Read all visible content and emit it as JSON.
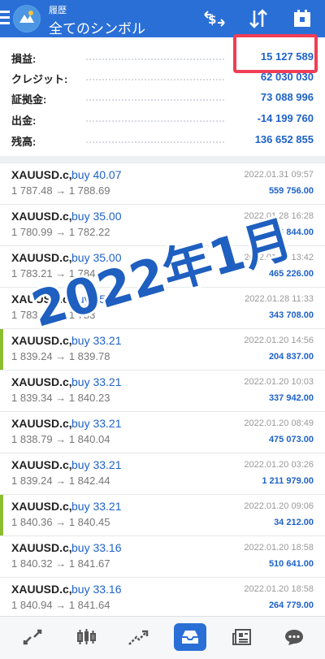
{
  "header": {
    "subtitle": "履歴",
    "title": "全てのシンボル"
  },
  "summary": [
    {
      "label": "損益:",
      "value": "15 127 589"
    },
    {
      "label": "クレジット:",
      "value": "62 030 030"
    },
    {
      "label": "証拠金:",
      "value": "73 088 996"
    },
    {
      "label": "出金:",
      "value": "-14 199 760"
    },
    {
      "label": "残高:",
      "value": "136 652 855"
    }
  ],
  "deals": [
    {
      "symbol": "XAUUSD.c,",
      "side": "buy 40.07",
      "prices": "1 787.48 → 1 788.69",
      "time": "2022.01.31 09:57",
      "profit": "559 756.00"
    },
    {
      "symbol": "XAUUSD.c,",
      "side": "buy 35.00",
      "prices": "1 780.99 → 1 782.22",
      "time": "2022.01.28 16:28",
      "profit": "496 844.00"
    },
    {
      "symbol": "XAUUSD.c,",
      "side": "buy 35.00",
      "prices": "1 783.21 → 1 784.3",
      "time": "2022.01.28 13:42",
      "profit": "465 226.00"
    },
    {
      "symbol": "XAUUSD.c,",
      "side": "buy 35.00",
      "prices": "1 783.21 → 1 783",
      "time": "2022.01.28 11:33",
      "profit": "343 708.00"
    },
    {
      "symbol": "XAUUSD.c,",
      "side": "buy 33.21",
      "prices": "1 839.24 → 1 839.78",
      "time": "2022.01.20 14:56",
      "profit": "204 837.00"
    },
    {
      "symbol": "XAUUSD.c,",
      "side": "buy 33.21",
      "prices": "1 839.34 → 1 840.23",
      "time": "2022.01.20 10:03",
      "profit": "337 942.00"
    },
    {
      "symbol": "XAUUSD.c,",
      "side": "buy 33.21",
      "prices": "1 838.79 → 1 840.04",
      "time": "2022.01.20 08:49",
      "profit": "475 073.00"
    },
    {
      "symbol": "XAUUSD.c,",
      "side": "buy 33.21",
      "prices": "1 839.24 → 1 842.44",
      "time": "2022.01.20 03:26",
      "profit": "1 211 979.00"
    },
    {
      "symbol": "XAUUSD.c,",
      "side": "buy 33.21",
      "prices": "1 840.36 → 1 840.45",
      "time": "2022.01.20 09:06",
      "profit": "34 212.00"
    },
    {
      "symbol": "XAUUSD.c,",
      "side": "buy 33.16",
      "prices": "1 840.32 → 1 841.67",
      "time": "2022.01.20 18:58",
      "profit": "510 641.00"
    },
    {
      "symbol": "XAUUSD.c,",
      "side": "buy 33.16",
      "prices": "1 840.94 → 1 841.64",
      "time": "2022.01.20 18:58",
      "profit": "264 779.00"
    }
  ],
  "watermark": "2022年1月",
  "colors": {
    "header": "#2a6fd6",
    "accent_blue": "#1e62c8",
    "highlight_red": "#ef3e55",
    "marker_green": "#8bbd2f"
  },
  "nav_icons": [
    "trade-icon",
    "chart-icon",
    "history-chart-icon",
    "inbox-icon",
    "news-icon",
    "chat-icon"
  ]
}
